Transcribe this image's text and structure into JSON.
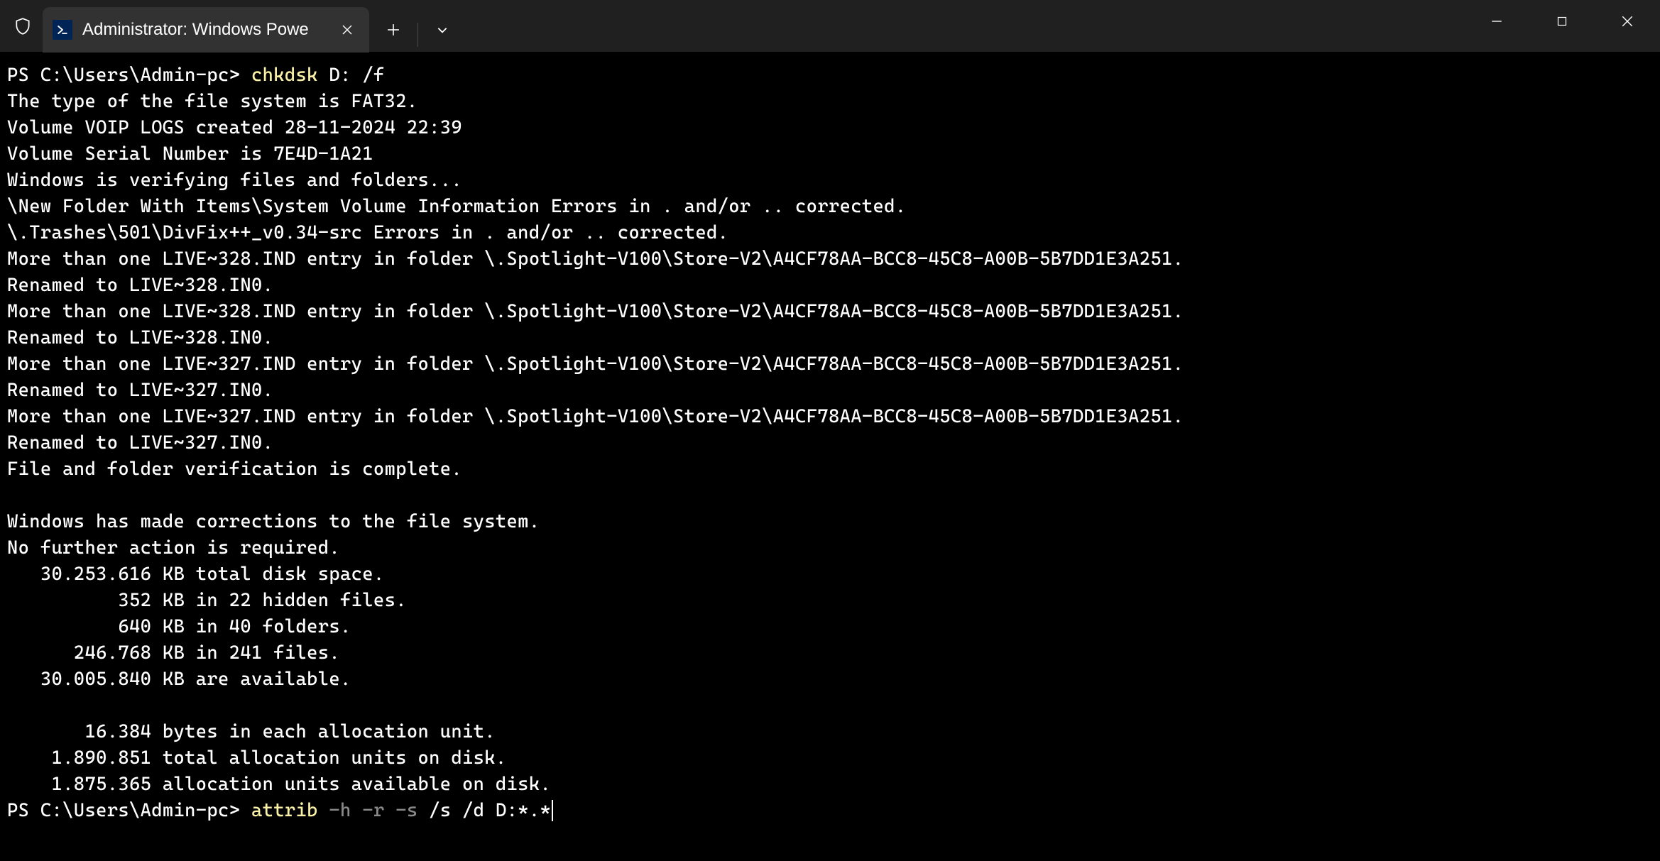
{
  "titlebar": {
    "tab_title": "Administrator: Windows Powe",
    "new_tab_label": "+",
    "dropdown_label": "⌄"
  },
  "terminal": {
    "prompt1_text": "PS C:\\Users\\Admin-pc> ",
    "cmd1_primary": "chkdsk",
    "cmd1_args": " D: /f",
    "out_line_01": "The type of the file system is FAT32.",
    "out_line_02": "Volume VOIP LOGS created 28-11-2024 22:39",
    "out_line_03": "Volume Serial Number is 7E4D-1A21",
    "out_line_04": "Windows is verifying files and folders...",
    "out_line_05": "\\New Folder With Items\\System Volume Information Errors in . and/or .. corrected.",
    "out_line_06": "\\.Trashes\\501\\DivFix++_v0.34-src Errors in . and/or .. corrected.",
    "out_line_07": "More than one LIVE~328.IND entry in folder \\.Spotlight-V100\\Store-V2\\A4CF78AA-BCC8-45C8-A00B-5B7DD1E3A251.",
    "out_line_08": "Renamed to LIVE~328.IN0.",
    "out_line_09": "More than one LIVE~328.IND entry in folder \\.Spotlight-V100\\Store-V2\\A4CF78AA-BCC8-45C8-A00B-5B7DD1E3A251.",
    "out_line_10": "Renamed to LIVE~328.IN0.",
    "out_line_11": "More than one LIVE~327.IND entry in folder \\.Spotlight-V100\\Store-V2\\A4CF78AA-BCC8-45C8-A00B-5B7DD1E3A251.",
    "out_line_12": "Renamed to LIVE~327.IN0.",
    "out_line_13": "More than one LIVE~327.IND entry in folder \\.Spotlight-V100\\Store-V2\\A4CF78AA-BCC8-45C8-A00B-5B7DD1E3A251.",
    "out_line_14": "Renamed to LIVE~327.IN0.",
    "out_line_15": "File and folder verification is complete.",
    "out_blank_16": "",
    "out_line_17": "Windows has made corrections to the file system.",
    "out_line_18": "No further action is required.",
    "out_line_19": "   30.253.616 KB total disk space.",
    "out_line_20": "          352 KB in 22 hidden files.",
    "out_line_21": "          640 KB in 40 folders.",
    "out_line_22": "      246.768 KB in 241 files.",
    "out_line_23": "   30.005.840 KB are available.",
    "out_blank_24": "",
    "out_line_25": "       16.384 bytes in each allocation unit.",
    "out_line_26": "    1.890.851 total allocation units on disk.",
    "out_line_27": "    1.875.365 allocation units available on disk.",
    "prompt2_text": "PS C:\\Users\\Admin-pc> ",
    "cmd2_primary": "attrib",
    "cmd2_flags": " -h -r -s",
    "cmd2_args": " /s /d D:*.*"
  }
}
